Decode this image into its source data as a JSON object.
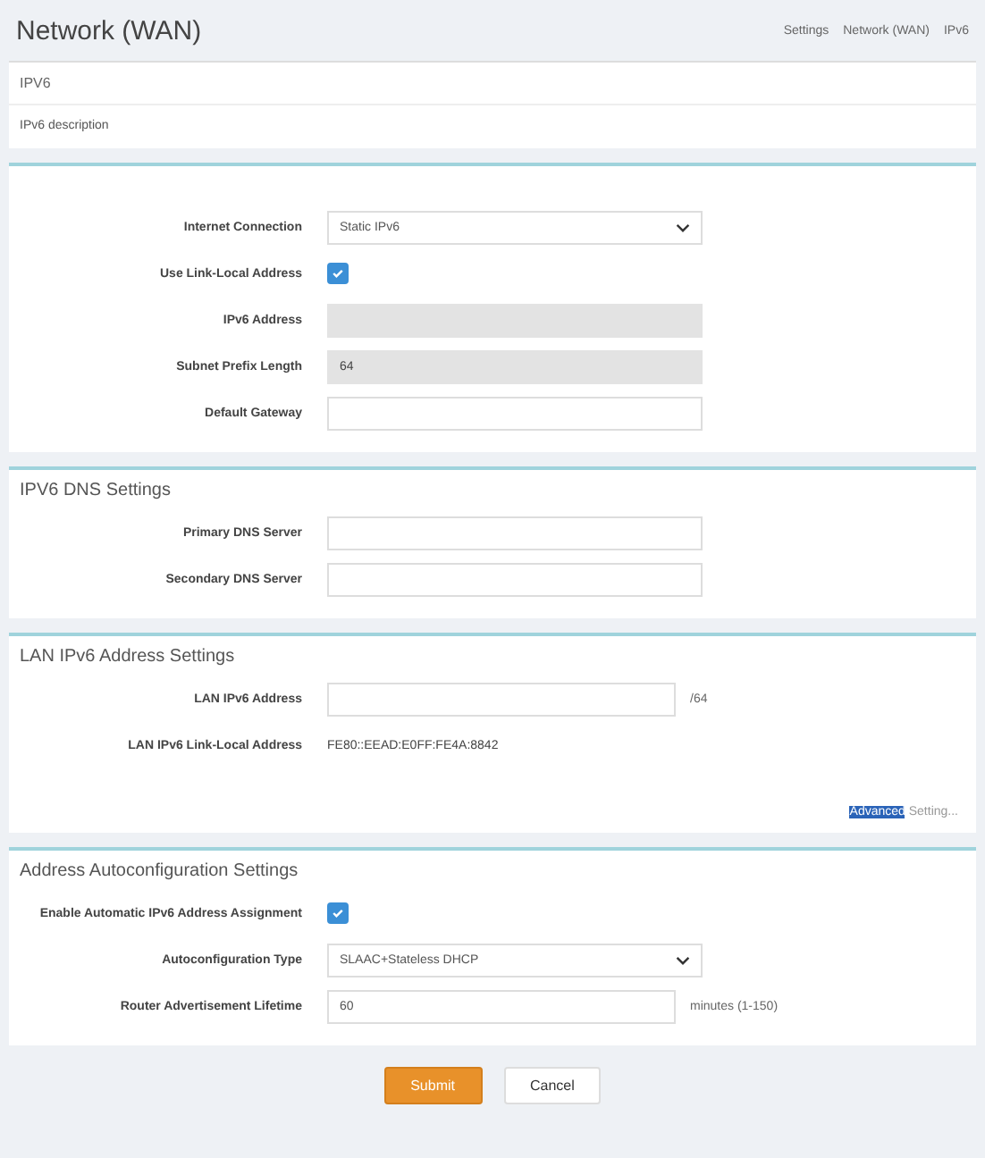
{
  "header": {
    "title": "Network (WAN)",
    "breadcrumb": [
      "Settings",
      "Network (WAN)",
      "IPv6"
    ]
  },
  "intro": {
    "title": "IPV6",
    "description": "IPv6 description"
  },
  "sections": [
    {
      "rows": [
        {
          "kind": "select",
          "label": "Internet Connection",
          "value": "Static IPv6"
        },
        {
          "kind": "checkbox",
          "label": "Use Link-Local Address",
          "checked": true
        },
        {
          "kind": "input",
          "label": "IPv6 Address",
          "value": "",
          "disabled": true
        },
        {
          "kind": "input",
          "label": "Subnet Prefix Length",
          "value": "64",
          "disabled": true
        },
        {
          "kind": "input",
          "label": "Default Gateway",
          "value": "",
          "disabled": false
        }
      ]
    },
    {
      "title": "IPV6 DNS Settings",
      "rows": [
        {
          "kind": "input",
          "label": "Primary DNS Server",
          "value": "",
          "disabled": false
        },
        {
          "kind": "input",
          "label": "Secondary DNS Server",
          "value": "",
          "disabled": false
        }
      ]
    },
    {
      "title": "LAN IPv6 Address Settings",
      "rows": [
        {
          "kind": "input",
          "label": "LAN IPv6 Address",
          "value": "",
          "disabled": false,
          "suffix": "/64"
        },
        {
          "kind": "text",
          "label": "LAN IPv6 Link-Local Address",
          "value": "FE80::EEAD:E0FF:FE4A:8842"
        }
      ],
      "link": {
        "highlighted": "Advanced",
        "text": "Setting..."
      }
    },
    {
      "title": "Address Autoconfiguration Settings",
      "rows": [
        {
          "kind": "checkbox",
          "label": "Enable Automatic IPv6 Address Assignment",
          "checked": true
        },
        {
          "kind": "select",
          "label": "Autoconfiguration Type",
          "value": "SLAAC+Stateless DHCP"
        },
        {
          "kind": "input",
          "label": "Router Advertisement Lifetime",
          "value": "60",
          "disabled": false,
          "suffix": "minutes (1-150)"
        }
      ]
    }
  ],
  "buttons": [
    {
      "kind": "primary",
      "label": "Submit"
    },
    {
      "kind": "secondary",
      "label": "Cancel"
    }
  ]
}
